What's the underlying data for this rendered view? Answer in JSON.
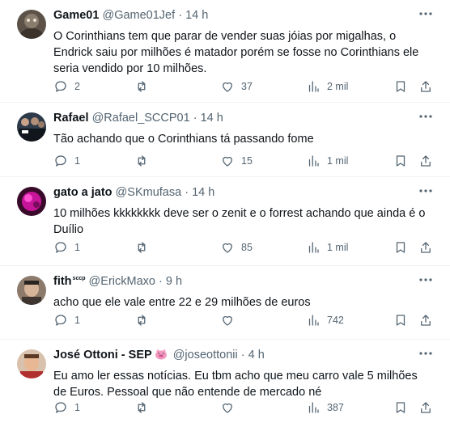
{
  "tweets": [
    {
      "name": "Game01",
      "handle": "@Game01Jef",
      "time": "14 h",
      "text": "O Corinthians tem que parar de vender suas jóias por migalhas, o Endrick saiu por milhões é matador porém se fosse no Corinthians ele seria vendido por 10 milhões.",
      "replies": "2",
      "reposts": "",
      "likes": "37",
      "views": "2 mil"
    },
    {
      "name": "Rafael",
      "handle": "@Rafael_SCCP01",
      "time": "14 h",
      "text": "Tão achando que o Corinthians tá passando fome",
      "replies": "1",
      "reposts": "",
      "likes": "15",
      "views": "1 mil"
    },
    {
      "name": "gato a jato",
      "handle": "@SKmufasa",
      "time": "14 h",
      "text": "10 milhões kkkkkkkk deve ser o zenit e o forrest achando que ainda é o Duílio",
      "replies": "1",
      "reposts": "",
      "likes": "85",
      "views": "1 mil"
    },
    {
      "name": "fith",
      "name_badge": "sccp",
      "handle": "@ErickMaxo",
      "time": "9 h",
      "text": "acho que ele vale entre 22 e 29 milhões de euros",
      "replies": "1",
      "reposts": "",
      "likes": "",
      "views": "742"
    },
    {
      "name": "José Ottoni - SEP",
      "handle": "@joseottonii",
      "time": "4 h",
      "text": "Eu amo ler essas notícias. Eu tbm acho que meu carro vale 5 milhões de Euros. Pessoal que não entende de mercado né",
      "replies": "1",
      "reposts": "",
      "likes": "",
      "views": "387"
    }
  ],
  "separator": "·",
  "icons": {
    "reply": "reply-icon",
    "repost": "repost-icon",
    "like": "heart-icon",
    "views": "views-chart-icon",
    "bookmark": "bookmark-icon",
    "share": "share-icon",
    "more": "more-options-icon",
    "pig": "pig-emoji-icon"
  },
  "colors": {
    "text": "#0f1419",
    "secondary": "#536471",
    "divider": "#eff3f4"
  }
}
